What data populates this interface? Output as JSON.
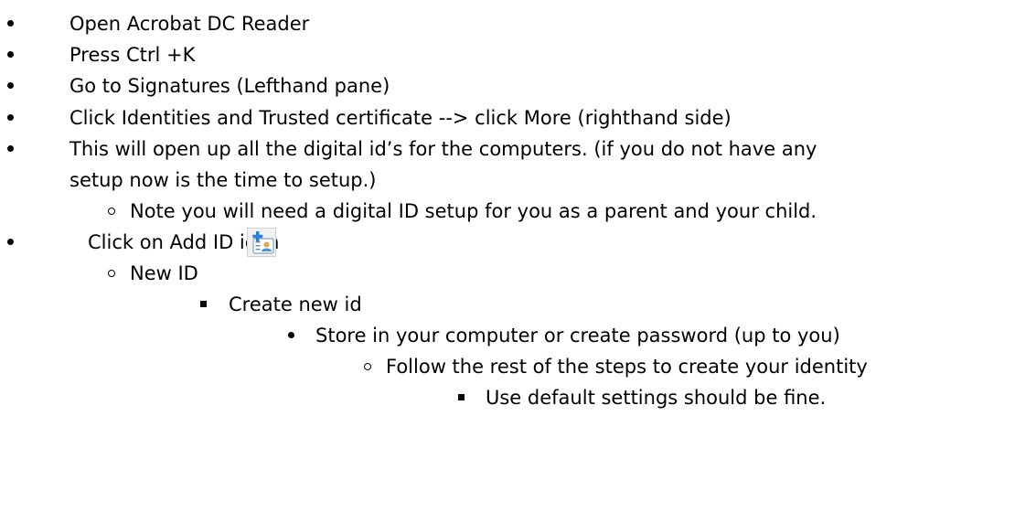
{
  "steps": {
    "s1": "Open Acrobat DC Reader",
    "s2": "Press Ctrl +K",
    "s3": "Go to Signatures (Lefthand pane)",
    "s4": "Click Identities and Trusted certificate --> click More (righthand side)",
    "s5_line1": "This will open up all the digital id’s for the computers. (if you do not have any",
    "s5_line2": "setup now is the time to setup.)",
    "s5_sub": "Note you will need a digital ID setup for you as a parent and your child.",
    "s6": "Click on Add ID icon",
    "s6_sub1": "New ID",
    "s6_sub2": "Create new id",
    "s6_sub3": "Store in your computer or create password (up to you)",
    "s6_sub4": "Follow the rest of the steps to create your identity",
    "s6_sub5": "Use default settings should be fine."
  },
  "icons": {
    "add_id": "add-id-icon"
  },
  "colors": {
    "text": "#000000",
    "icon_plus": "#2f7dd1",
    "icon_person": "#e9a64a"
  }
}
